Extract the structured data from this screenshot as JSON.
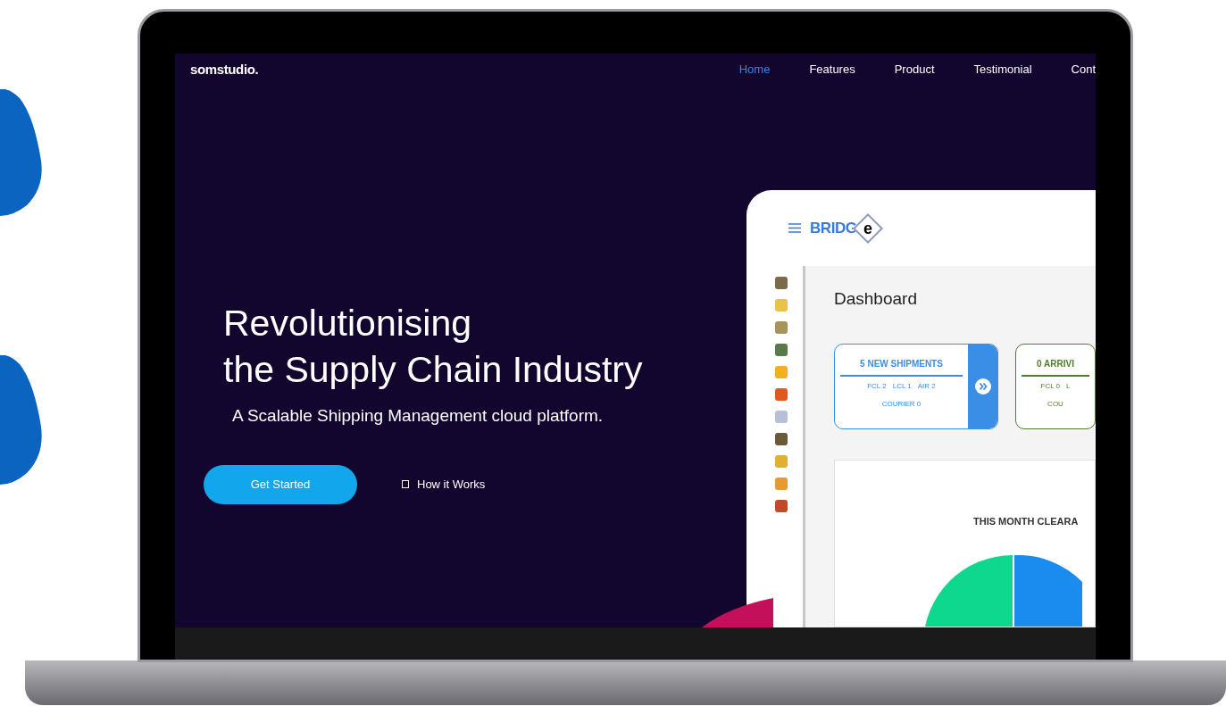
{
  "site": {
    "logo": "somstudio.",
    "nav": [
      {
        "label": "Home",
        "selected": true
      },
      {
        "label": "Features",
        "selected": false
      },
      {
        "label": "Product",
        "selected": false
      },
      {
        "label": "Testimonial",
        "selected": false
      },
      {
        "label": "Cont",
        "selected": false
      }
    ]
  },
  "hero": {
    "title_lines": [
      "Revolutionising",
      "the Supply Chain Industry"
    ],
    "subtitle": "A Scalable Shipping Management cloud platform.",
    "primary_button": "Get Started",
    "secondary_link": "How it Works"
  },
  "dashboard": {
    "logo_text": "BRIDG",
    "logo_mark": "e",
    "heading": "Dashboard",
    "cards": [
      {
        "title": "5 NEW SHIPMENTS",
        "stats": [
          "FCL 2",
          "LCL 1",
          "AIR 2"
        ],
        "footer": "COURIER 0",
        "color": "#3a8ee6",
        "has_arrow": true
      },
      {
        "title": "0 ARRIVI",
        "stats": [
          "FCL 0",
          "L"
        ],
        "footer": "COU",
        "color": "#4f7d2c",
        "has_arrow": false
      }
    ],
    "chart_title": "THIS MONTH CLEARA"
  }
}
